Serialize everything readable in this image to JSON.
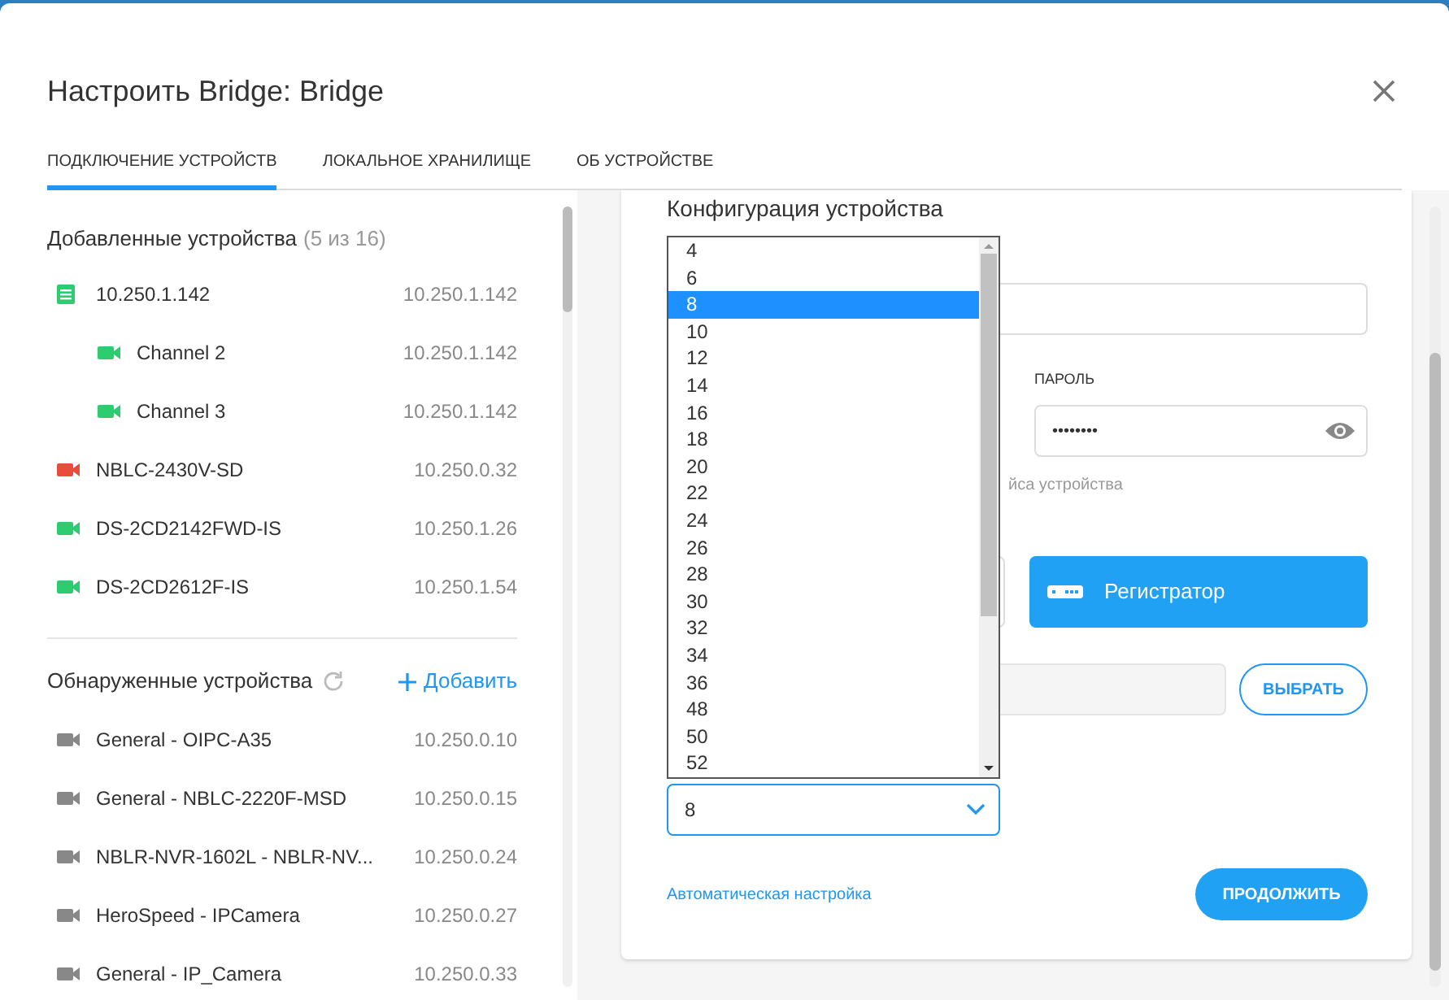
{
  "dialog": {
    "title": "Настроить Bridge: Bridge"
  },
  "tabs": [
    {
      "label": "ПОДКЛЮЧЕНИЕ УСТРОЙСТВ",
      "selected": true
    },
    {
      "label": "ЛОКАЛЬНОЕ ХРАНИЛИЩЕ",
      "selected": false
    },
    {
      "label": "ОБ УСТРОЙСТВЕ",
      "selected": false
    }
  ],
  "added_devices": {
    "title": "Добавленные устройства",
    "count": "(5 из 16)",
    "items": [
      {
        "kind": "recorder",
        "color": "#2ecc71",
        "name": "10.250.1.142",
        "ip": "10.250.1.142",
        "children": [
          {
            "kind": "camera",
            "color": "#2ecc71",
            "name": "Channel 2",
            "ip": "10.250.1.142"
          },
          {
            "kind": "camera",
            "color": "#2ecc71",
            "name": "Channel 3",
            "ip": "10.250.1.142"
          }
        ]
      },
      {
        "kind": "camera",
        "color": "#e74c3c",
        "name": "NBLC-2430V-SD",
        "ip": "10.250.0.32"
      },
      {
        "kind": "camera",
        "color": "#2ecc71",
        "name": "DS-2CD2142FWD-IS",
        "ip": "10.250.1.26"
      },
      {
        "kind": "camera",
        "color": "#2ecc71",
        "name": "DS-2CD2612F-IS",
        "ip": "10.250.1.54"
      }
    ]
  },
  "discovered_devices": {
    "title": "Обнаруженные устройства",
    "add_label": "Добавить",
    "items": [
      {
        "name": "General - OIPC-A35",
        "ip": "10.250.0.10"
      },
      {
        "name": "General - NBLC-2220F-MSD",
        "ip": "10.250.0.15"
      },
      {
        "name": "NBLR-NVR-1602L - NBLR-NV...",
        "ip": "10.250.0.24"
      },
      {
        "name": "HeroSpeed - IPCamera",
        "ip": "10.250.0.27"
      },
      {
        "name": "General - IP_Camera",
        "ip": "10.250.0.33"
      }
    ]
  },
  "config": {
    "title": "Конфигурация устройства",
    "password_label": "ПАРОЛЬ",
    "password_value": "••••••••",
    "hint": "йса устройства",
    "type_button": "Регистратор",
    "choose_button": "ВЫБРАТЬ",
    "channels_value": "8",
    "auto_link": "Автоматическая настройка",
    "continue_button": "ПРОДОЛЖИТЬ"
  },
  "channel_options": [
    {
      "label": "4",
      "selected": false
    },
    {
      "label": "6",
      "selected": false
    },
    {
      "label": "8",
      "selected": true
    },
    {
      "label": "10",
      "selected": false
    },
    {
      "label": "12",
      "selected": false
    },
    {
      "label": "14",
      "selected": false
    },
    {
      "label": "16",
      "selected": false
    },
    {
      "label": "18",
      "selected": false
    },
    {
      "label": "20",
      "selected": false
    },
    {
      "label": "22",
      "selected": false
    },
    {
      "label": "24",
      "selected": false
    },
    {
      "label": "26",
      "selected": false
    },
    {
      "label": "28",
      "selected": false
    },
    {
      "label": "30",
      "selected": false
    },
    {
      "label": "32",
      "selected": false
    },
    {
      "label": "34",
      "selected": false
    },
    {
      "label": "36",
      "selected": false
    },
    {
      "label": "48",
      "selected": false
    },
    {
      "label": "50",
      "selected": false
    },
    {
      "label": "52",
      "selected": false
    }
  ]
}
